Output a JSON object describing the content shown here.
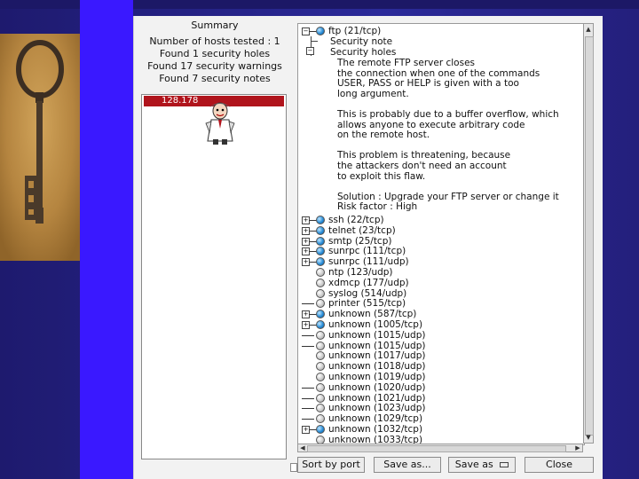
{
  "summary": {
    "title": "Summary",
    "lines": [
      "Number of hosts tested : 1",
      "Found 1 security holes",
      "Found 17 security warnings",
      "Found 7 security notes"
    ]
  },
  "hosts": [
    {
      "label": "128.178"
    }
  ],
  "tree": {
    "ftp": {
      "label": "ftp (21/tcp)",
      "children": [
        "Security note",
        "Security holes"
      ],
      "description": [
        "The remote FTP server closes",
        "the connection when one of the commands",
        "USER, PASS or HELP is given with a too",
        "long argument.",
        "",
        "This is probably due to a buffer overflow, which",
        "allows anyone to execute arbitrary code",
        "on the remote host.",
        "",
        "This problem is threatening, because",
        "the attackers don't need an account",
        "to exploit this flaw.",
        "",
        "Solution : Upgrade your FTP server or change it",
        "Risk factor : High"
      ]
    },
    "ports": [
      {
        "label": "ssh (22/tcp)",
        "dot": "blue",
        "expander": "plus"
      },
      {
        "label": "telnet (23/tcp)",
        "dot": "blue",
        "expander": "plus"
      },
      {
        "label": "smtp (25/tcp)",
        "dot": "blue",
        "expander": "plus"
      },
      {
        "label": "sunrpc (111/tcp)",
        "dot": "blue",
        "expander": "plus"
      },
      {
        "label": "sunrpc (111/udp)",
        "dot": "blue",
        "expander": "plus"
      },
      {
        "label": "ntp (123/udp)",
        "dot": "grey",
        "expander": "none"
      },
      {
        "label": "xdmcp (177/udp)",
        "dot": "grey",
        "expander": "none"
      },
      {
        "label": "syslog (514/udp)",
        "dot": "grey",
        "expander": "none"
      },
      {
        "label": "printer (515/tcp)",
        "dot": "grey",
        "expander": "dash"
      },
      {
        "label": "unknown (587/tcp)",
        "dot": "blue",
        "expander": "plus"
      },
      {
        "label": "unknown (1005/tcp)",
        "dot": "blue",
        "expander": "plus"
      },
      {
        "label": "unknown (1015/udp)",
        "dot": "grey",
        "expander": "dash"
      },
      {
        "label": "unknown (1015/udp)",
        "dot": "grey",
        "expander": "dash"
      },
      {
        "label": "unknown (1017/udp)",
        "dot": "grey",
        "expander": "none"
      },
      {
        "label": "unknown (1018/udp)",
        "dot": "grey",
        "expander": "none"
      },
      {
        "label": "unknown (1019/udp)",
        "dot": "grey",
        "expander": "none"
      },
      {
        "label": "unknown (1020/udp)",
        "dot": "grey",
        "expander": "dash"
      },
      {
        "label": "unknown (1021/udp)",
        "dot": "grey",
        "expander": "dash"
      },
      {
        "label": "unknown (1023/udp)",
        "dot": "grey",
        "expander": "dash"
      },
      {
        "label": "unknown (1029/tcp)",
        "dot": "grey",
        "expander": "dash"
      },
      {
        "label": "unknown (1032/tcp)",
        "dot": "blue",
        "expander": "plus"
      },
      {
        "label": "unknown (1033/tcp)",
        "dot": "grey",
        "expander": "none"
      }
    ]
  },
  "buttons": {
    "sort": "Sort by port",
    "save_as": "Save as...",
    "save_as_menu": "Save as",
    "close": "Close"
  },
  "colors": {
    "selected_host": "#b0141c",
    "note_dot": "#2a8ed8",
    "stripe": "#3a18ff"
  }
}
